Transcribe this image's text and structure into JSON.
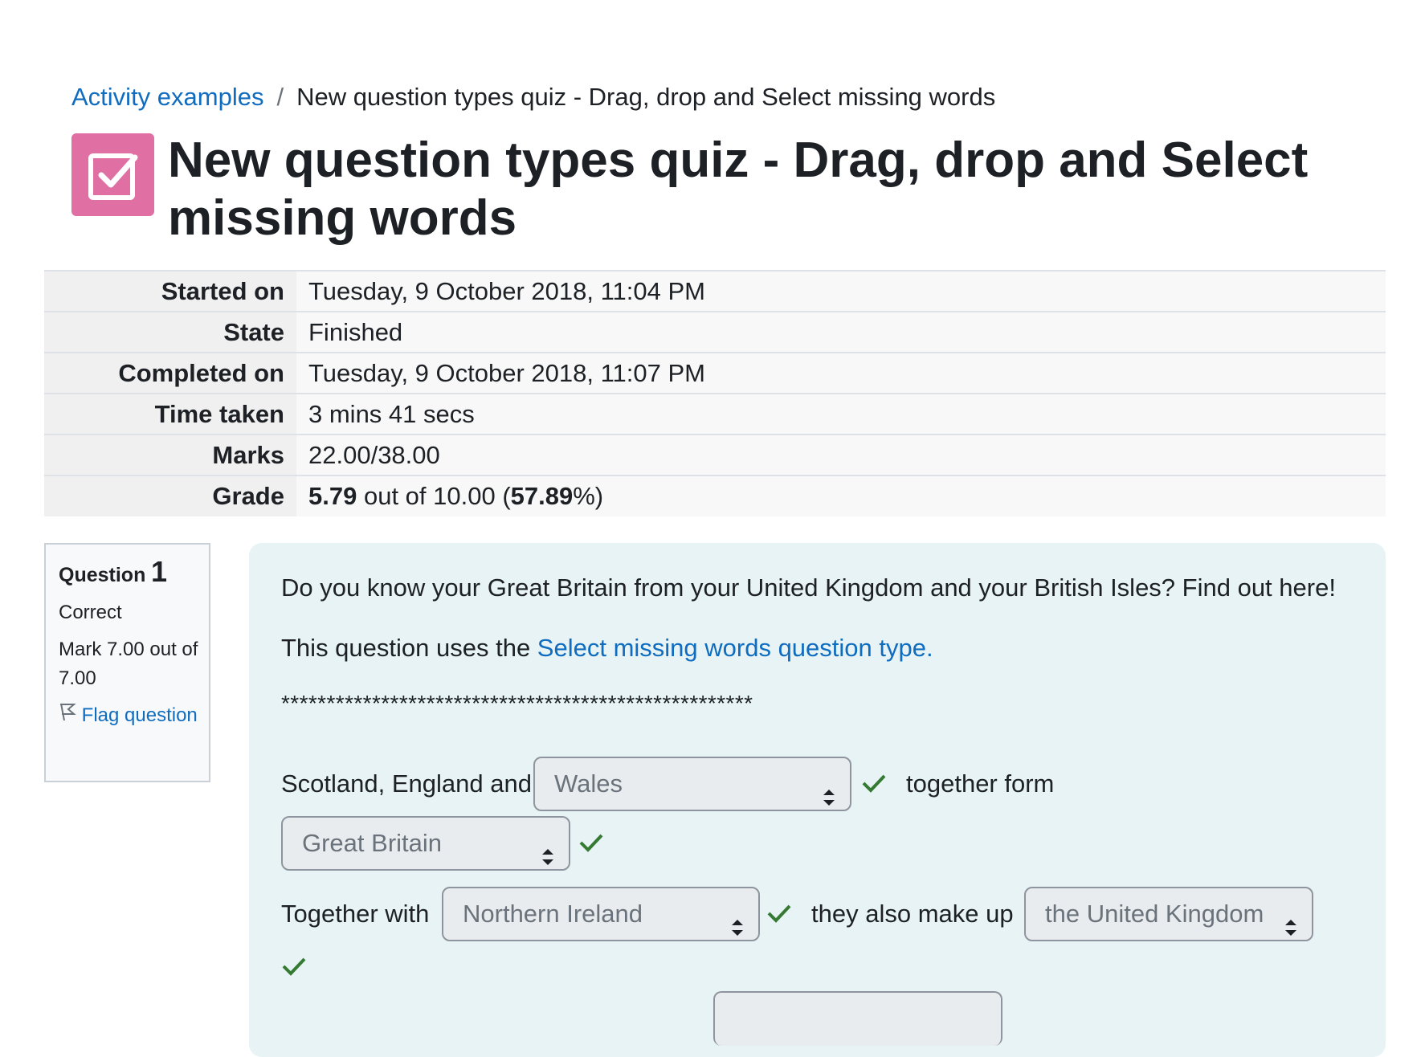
{
  "breadcrumb": {
    "link": "Activity examples",
    "separator": "/",
    "current": "New question types quiz - Drag, drop and Select missing words"
  },
  "activity_icon": "quiz-checkbox-icon",
  "page_title": "New question types quiz - Drag, drop and Select missing words",
  "summary": {
    "started_label": "Started on",
    "started_value": "Tuesday, 9 October 2018, 11:04 PM",
    "state_label": "State",
    "state_value": "Finished",
    "completed_label": "Completed on",
    "completed_value": "Tuesday, 9 October 2018, 11:07 PM",
    "time_label": "Time taken",
    "time_value": "3 mins 41 secs",
    "marks_label": "Marks",
    "marks_value": "22.00/38.00",
    "grade_label": "Grade",
    "grade_score": "5.79",
    "grade_outof": " out of 10.00 (",
    "grade_percent": "57.89",
    "grade_end": "%)"
  },
  "question_info": {
    "label": "Question",
    "number": "1",
    "state": "Correct",
    "mark": "Mark 7.00 out of 7.00",
    "flag_label": "Flag question",
    "flag_icon": "flag-icon"
  },
  "question": {
    "intro": "Do you know your Great Britain from your United Kingdom and your British Isles? Find out here!",
    "type_prefix": "This question uses the ",
    "type_link": "Select missing words question type.",
    "divider": "****************************************************",
    "text_1": "Scotland, England and",
    "select_1": "Wales",
    "text_2": "together form",
    "select_2": "Great Britain",
    "text_3": "Together with",
    "select_3": "Northern Ireland",
    "text_4": "they also make up",
    "select_4": "the United Kingdom",
    "select_5": "",
    "tick_color": "#357a32",
    "accent_color": "#0f6cbf",
    "icon_color": "#e06fa4"
  }
}
